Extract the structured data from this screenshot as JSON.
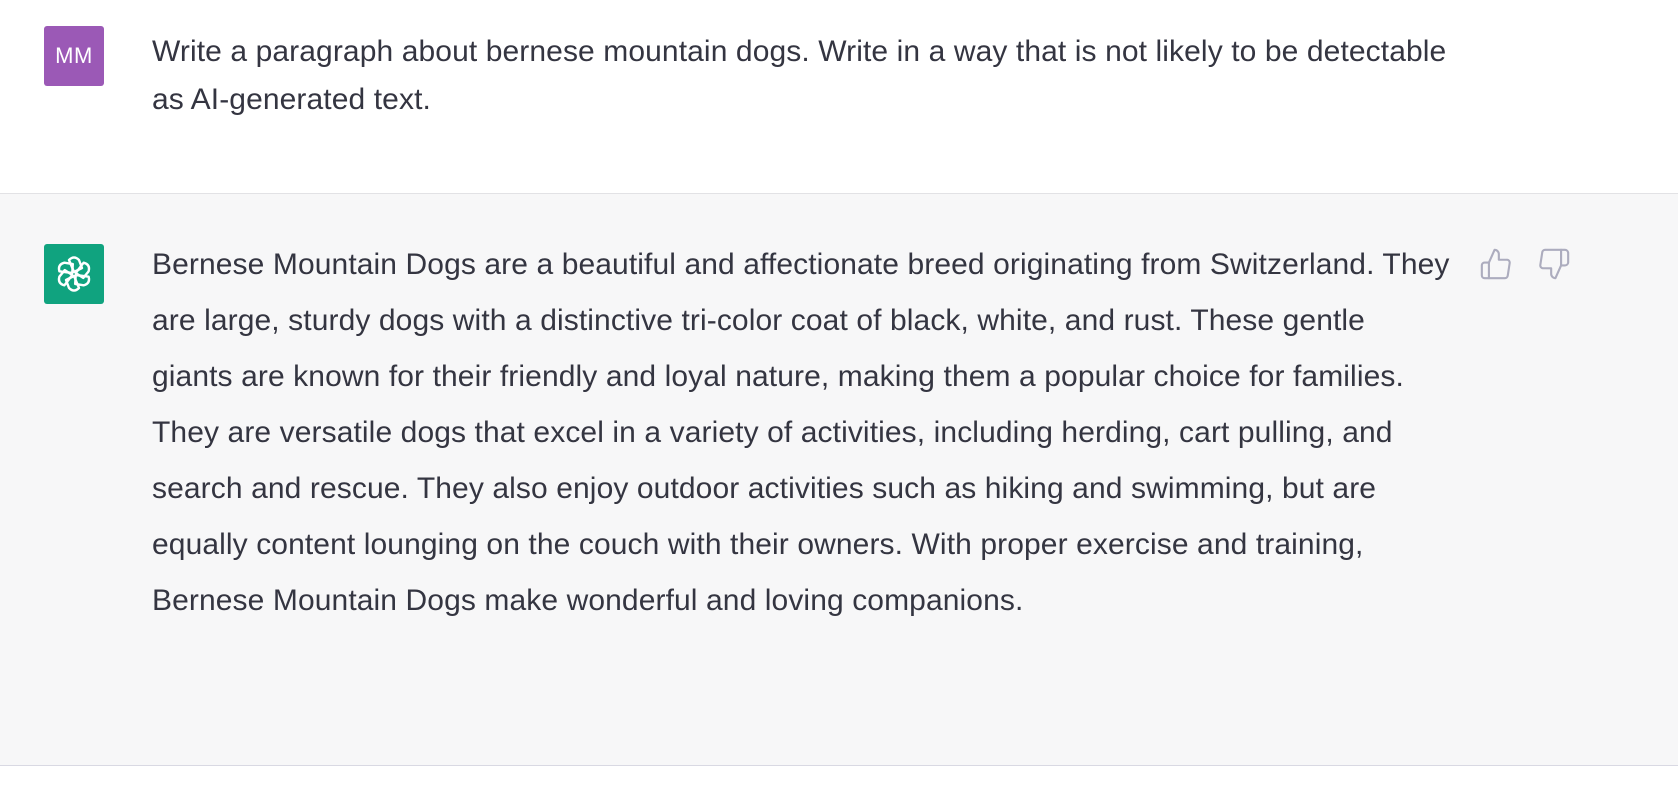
{
  "conversation": {
    "user_message": {
      "avatar_initials": "MM",
      "avatar_color": "#9b59b6",
      "text": "Write a paragraph about bernese mountain dogs. Write in a way that is not likely to be detectable as AI-generated text."
    },
    "assistant_message": {
      "avatar_icon": "openai-logo-icon",
      "avatar_color": "#10a37f",
      "text": "Bernese Mountain Dogs are a beautiful and affectionate breed originating from Switzerland. They are large, sturdy dogs with a distinctive tri-color coat of black, white, and rust. These gentle giants are known for their friendly and loyal nature, making them a popular choice for families. They are versatile dogs that excel in a variety of activities, including herding, cart pulling, and search and rescue. They also enjoy outdoor activities such as hiking and swimming, but are equally content lounging on the couch with their owners. With proper exercise and training, Bernese Mountain Dogs make wonderful and loving companions.",
      "feedback": {
        "thumbs_up_icon": "thumbs-up-icon",
        "thumbs_down_icon": "thumbs-down-icon"
      }
    }
  }
}
